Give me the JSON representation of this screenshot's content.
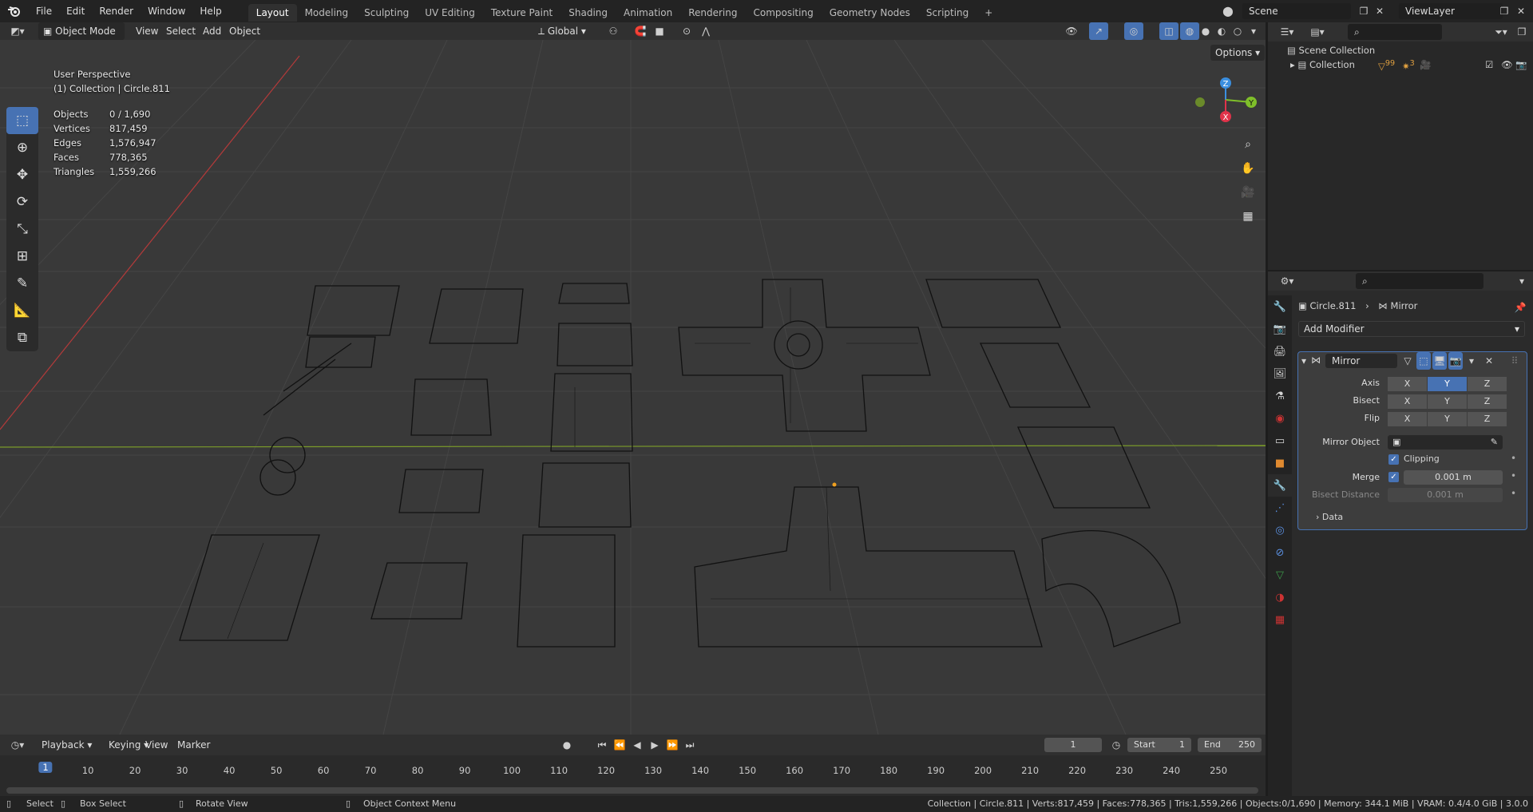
{
  "menu": {
    "file": "File",
    "edit": "Edit",
    "render": "Render",
    "window": "Window",
    "help": "Help"
  },
  "workspaces": [
    "Layout",
    "Modeling",
    "Sculpting",
    "UV Editing",
    "Texture Paint",
    "Shading",
    "Animation",
    "Rendering",
    "Compositing",
    "Geometry Nodes",
    "Scripting"
  ],
  "active_workspace": "Layout",
  "scene": {
    "label": "Scene",
    "view_layer": "ViewLayer"
  },
  "viewport_header": {
    "mode": "Object Mode",
    "view": "View",
    "select": "Select",
    "add": "Add",
    "object": "Object",
    "orientation": "Global",
    "options": "Options"
  },
  "viewport_overlay": {
    "perspective": "User Perspective",
    "collection_info": "(1) Collection | Circle.811"
  },
  "stats": [
    {
      "k": "Objects",
      "v": "0 / 1,690"
    },
    {
      "k": "Vertices",
      "v": "817,459"
    },
    {
      "k": "Edges",
      "v": "1,576,947"
    },
    {
      "k": "Faces",
      "v": "778,365"
    },
    {
      "k": "Triangles",
      "v": "1,559,266"
    }
  ],
  "gizmo": {
    "z": "Z",
    "y": "Y",
    "x": "X"
  },
  "outliner": {
    "scene_collection": "Scene Collection",
    "collection": "Collection",
    "badge1": "99",
    "badge2": "3"
  },
  "properties": {
    "object": "Circle.811",
    "modifier": "Mirror",
    "add_modifier": "Add Modifier",
    "modifier_name": "Mirror",
    "axis_label": "Axis",
    "bisect_label": "Bisect",
    "flip_label": "Flip",
    "axes": [
      "X",
      "Y",
      "Z"
    ],
    "axis_active": "Y",
    "mirror_object_label": "Mirror Object",
    "clipping_label": "Clipping",
    "merge_label": "Merge",
    "merge_value": "0.001 m",
    "bisect_distance_label": "Bisect Distance",
    "bisect_distance_value": "0.001 m",
    "data_label": "Data"
  },
  "timeline": {
    "playback": "Playback",
    "keying": "Keying",
    "view": "View",
    "marker": "Marker",
    "current_frame": "1",
    "start_label": "Start",
    "start": "1",
    "end_label": "End",
    "end": "250",
    "ticks": [
      "1",
      "10",
      "20",
      "30",
      "40",
      "50",
      "60",
      "70",
      "80",
      "90",
      "100",
      "110",
      "120",
      "130",
      "140",
      "150",
      "160",
      "170",
      "180",
      "190",
      "200",
      "210",
      "220",
      "230",
      "240",
      "250"
    ]
  },
  "statusbar": {
    "select": "Select",
    "box_select": "Box Select",
    "rotate_view": "Rotate View",
    "context_menu": "Object Context Menu",
    "info": "Collection | Circle.811 | Verts:817,459 | Faces:778,365 | Tris:1,559,266 | Objects:0/1,690 | Memory: 344.1 MiB | VRAM: 0.4/4.0 GiB | 3.0.0"
  },
  "colors": {
    "accent": "#4772b3",
    "x_axis": "#e0334a",
    "y_axis": "#7fbf2a",
    "z_axis": "#3b8fe0"
  }
}
